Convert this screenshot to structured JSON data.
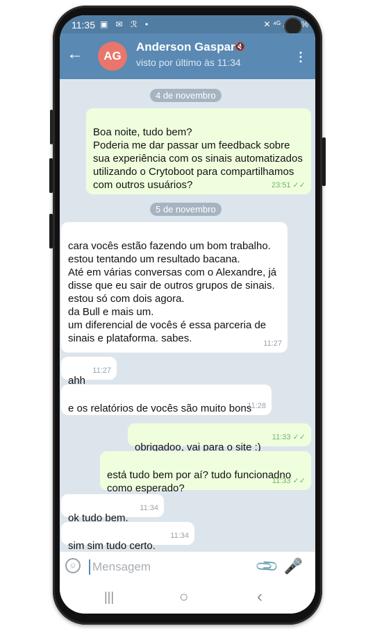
{
  "status_bar": {
    "time": "11:35",
    "left_icons": "▣ ✉ ℛ •",
    "right_icons": "✕ ⁴ᴳ .ıl 21%"
  },
  "header": {
    "back_icon": "←",
    "avatar_initials": "AG",
    "name": "Anderson Gaspar",
    "mute_icon": "🔇",
    "status": "visto por último às 11:34",
    "menu_icon": "⋮",
    "colors": {
      "header_bg": "#5a89b3",
      "avatar_bg": "#e8766c"
    }
  },
  "dates": [
    "4 de novembro",
    "5 de novembro"
  ],
  "messages": [
    {
      "dir": "out",
      "text": "Boa noite, tudo bem?\nPoderia me dar passar um feedback sobre sua experiência com os sinais automatizados utilizando o Crytoboot para compartilhamos com outros usuários?",
      "time": "23:51 ✓✓"
    },
    {
      "dir": "in",
      "text": "cara vocês estão fazendo um bom trabalho.\nestou tentando um resultado bacana.\nAté em várias conversas com o Alexandre, já disse que eu sair de outros grupos de sinais. estou só com dois agora.\nda Bull e mais um.\num diferencial de vocês é essa parceria de sinais e plataforma. sabes.",
      "time": "11:27"
    },
    {
      "dir": "in",
      "text": "ahh",
      "time": "11:27"
    },
    {
      "dir": "in",
      "text": "e os relatórios de vocês são muito bons",
      "time": "11:28"
    },
    {
      "dir": "out",
      "text": "obrigadoo, vai para o site :)",
      "time": "11:33 ✓✓"
    },
    {
      "dir": "out",
      "text": "está tudo bem por aí? tudo funcionadno como esperado?",
      "time": "11:33 ✓✓"
    },
    {
      "dir": "in",
      "text": "ok tudo bem.",
      "time": "11:34"
    },
    {
      "dir": "in",
      "text": "sim sim tudo certo.",
      "time": "11:34"
    }
  ],
  "input": {
    "placeholder": "Mensagem",
    "emoji_icon": "☺",
    "attach_icon": "📎",
    "mic_icon": "🎤"
  },
  "navbar": {
    "recent_icon": "|||",
    "home_icon": "○",
    "back_icon": "‹"
  }
}
